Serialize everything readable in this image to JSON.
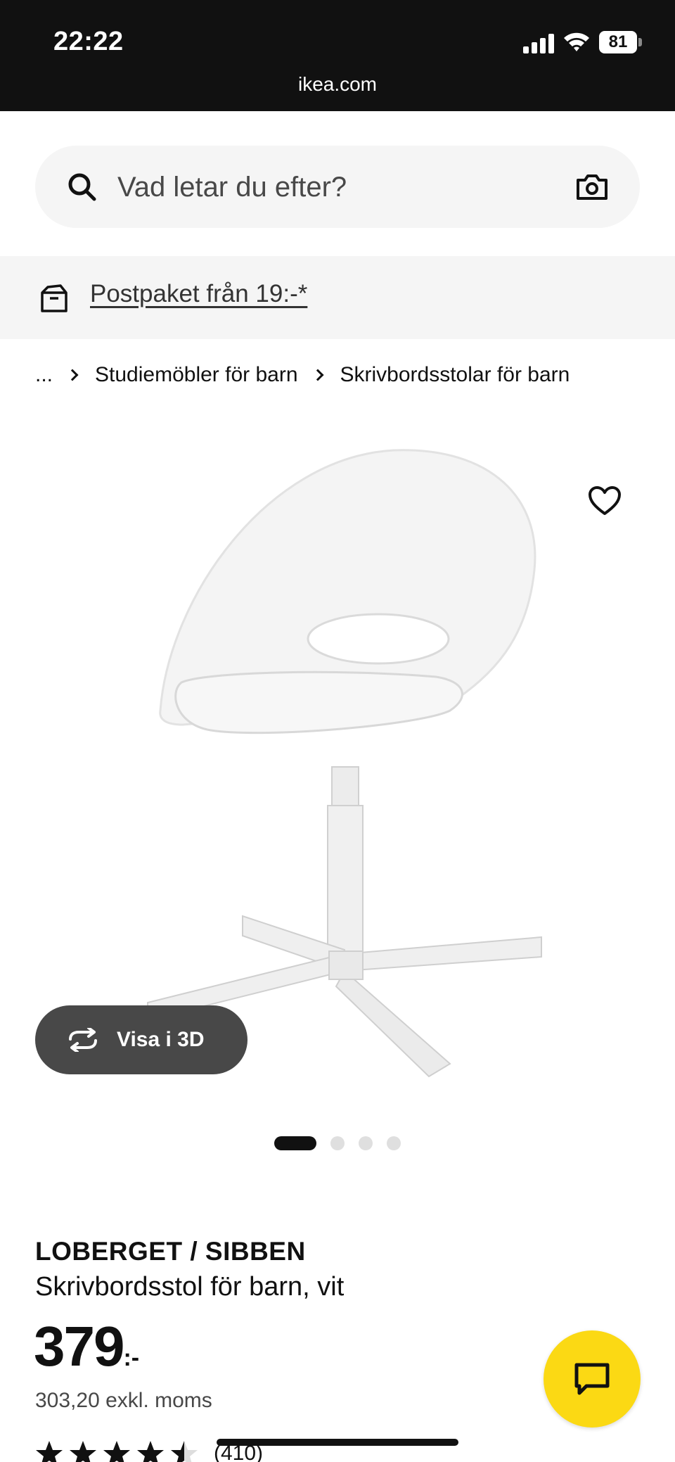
{
  "status_bar": {
    "time": "22:22",
    "battery": "81",
    "url": "ikea.com"
  },
  "search": {
    "placeholder": "Vad letar du efter?"
  },
  "promo": {
    "text": "Postpaket från 19:-*"
  },
  "breadcrumb": {
    "ellipsis": "...",
    "items": [
      "Studiemöbler för barn",
      "Skrivbordsstolar för barn"
    ]
  },
  "gallery": {
    "view_3d_label": "Visa i 3D",
    "dot_count": 4,
    "active_index": 0
  },
  "product": {
    "name": "LOBERGET / SIBBEN",
    "description": "Skrivbordsstol för barn, vit",
    "price_integer": "379",
    "price_suffix": ":-",
    "price_ex_vat": "303,20 exkl. moms",
    "rating": 4.5,
    "review_count": "(410)"
  },
  "colors": {
    "chat_button": "#fbd914",
    "status_bar": "#111111"
  }
}
